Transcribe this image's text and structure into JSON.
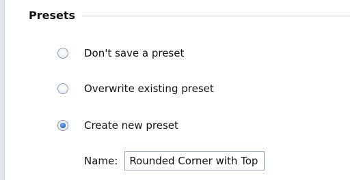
{
  "presets": {
    "title": "Presets",
    "options": [
      {
        "label": "Don't save a preset",
        "checked": false
      },
      {
        "label": "Overwrite existing preset",
        "checked": false
      },
      {
        "label": "Create new preset",
        "checked": true
      }
    ],
    "name_label": "Name:",
    "name_value": "Rounded Corner with Top Nav"
  }
}
